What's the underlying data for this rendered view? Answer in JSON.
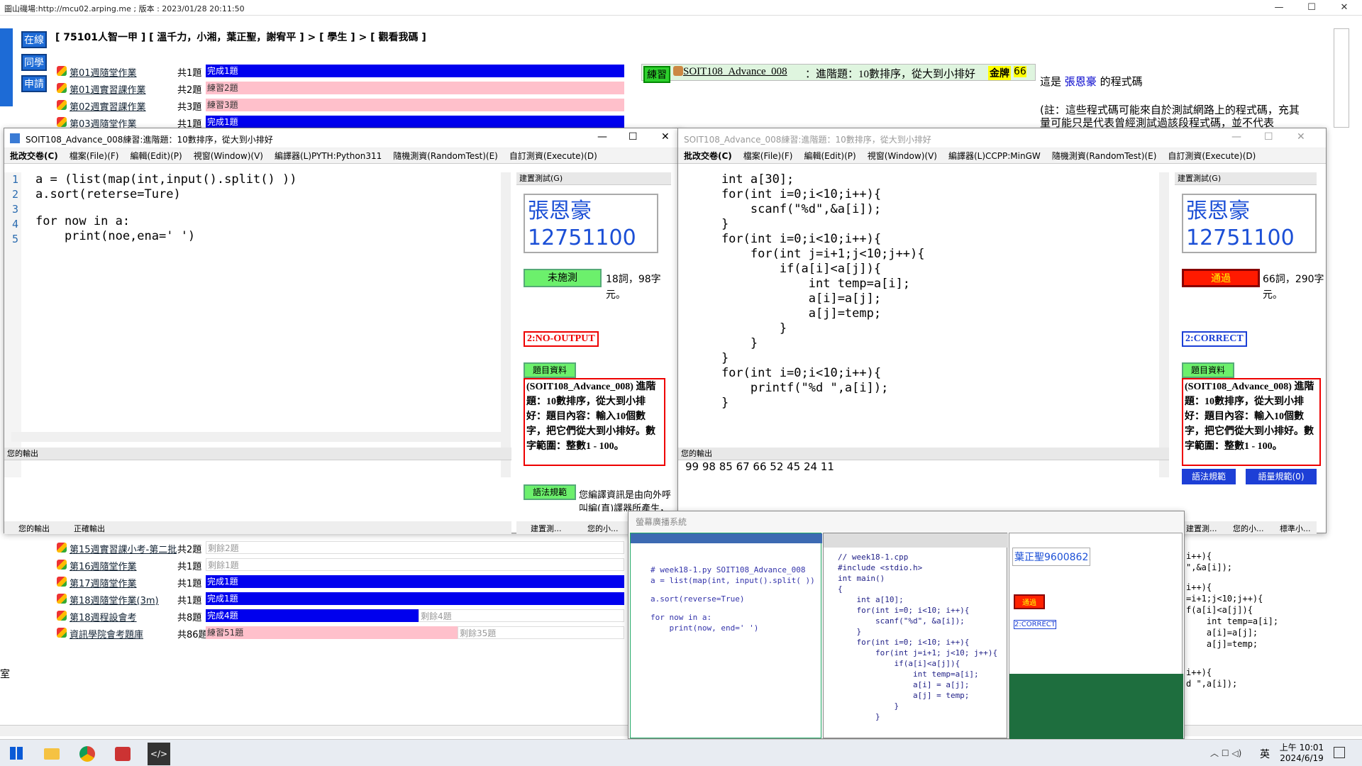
{
  "titlebar": {
    "text": "圖山磯場:http://mcu02.arping.me ; 版本 : 2023/01/28 20:11:50",
    "min": "—",
    "max": "☐",
    "close": "✕"
  },
  "nav": {
    "online": "在線",
    "classmates": "同學",
    "appeal": "申請"
  },
  "crumb": "[ 75101人智一甲 ] [ 溫千力，小湘，葉正聖，謝宥平 ] > [ 學生 ] > [ 觀看我碼 ]",
  "rows_top": [
    {
      "name": "第01週隨堂作業",
      "count": "共1題",
      "status": "完成1題",
      "style": "blue",
      "width": 590
    },
    {
      "name": "第01週實習課作業",
      "count": "共2題",
      "status": "練習2題",
      "style": "pink",
      "width": 590
    },
    {
      "name": "第02週實習課作業",
      "count": "共3題",
      "status": "練習3題",
      "style": "pink",
      "width": 590
    },
    {
      "name": "第03週隨堂作業",
      "count": "共1題",
      "status": "完成1題",
      "style": "blue",
      "width": 590
    }
  ],
  "rows_bottom": [
    {
      "name": "第15週實習課小考-第二批",
      "count": "共2題",
      "status": "剩餘2題",
      "style": "gray",
      "width": 590
    },
    {
      "name": "第16週隨堂作業",
      "count": "共1題",
      "status": "剩餘1題",
      "style": "gray",
      "width": 590
    },
    {
      "name": "第17週隨堂作業",
      "count": "共1題",
      "status": "完成1題",
      "style": "blue",
      "width": 590
    },
    {
      "name": "第18週隨堂作業(3m)",
      "count": "共1題",
      "status": "完成1題",
      "style": "blue",
      "width": 590
    },
    {
      "name": "第18週程設會考",
      "count": "共8題",
      "status": "完成4題",
      "rest": "剩餘4題",
      "style": "blue",
      "width": 300
    },
    {
      "name": "資訊學院會考題庫",
      "count": "共86題",
      "status": "練習51題",
      "rest": "剩餘35題",
      "style": "pink",
      "width": 355
    }
  ],
  "problem_header": {
    "badge": "練習",
    "title": "SOIT108_Advance_008",
    "desc": "：進階題：10數排序，從大到小排好",
    "medal": "金牌",
    "score": "66"
  },
  "info": {
    "owner_prefix": "這是",
    "owner": "張恩豪",
    "owner_suffix": "的程式碼",
    "note": "(註：這些程式碼可能來自於測試網路上的程式碼，充其量可能只是代表曾經測試過該段程式碼，並不代表"
  },
  "left_win": {
    "title": "SOIT108_Advance_008練習:進階題：10數排序，從大到小排好",
    "menu": [
      "批改交卷(C)",
      "檔案(File)(F)",
      "編輯(Edit)(P)",
      "視窗(Window)(V)",
      "編譯器(L)PYTH:Python311",
      "隨機測資(RandomTest)(E)",
      "自訂測資(Execute)(D)"
    ],
    "lines": [
      "1",
      "2",
      "3",
      "4",
      "5"
    ],
    "code": [
      "a = (list(map(int,input().split() ))",
      "a.sort(reterse=Ture)",
      "",
      "for now in a:",
      "    print(noe,ena=' ')"
    ],
    "panel": "建置測試(G)",
    "name": "張恩豪",
    "id": "12751100",
    "status_btn": "未施測",
    "stats": "18詞，98字元。",
    "result": "2:NO-OUTPUT",
    "info_btn": "題目資料",
    "desc": "(SOIT108_Advance_008) 進階題：10數排序，從大到小排好：題目內容：輸入10個數字，把它們從大到小排好。數字範圍：整數1 - 100。",
    "syntax_btn": "語法規範",
    "syntax_note": "您編譯資訊是由向外呼叫編(直)譯器所產生，編(直)譯",
    "out_hdr": "您的輸出",
    "tabs": [
      "您的輸出",
      "正確輸出"
    ],
    "ptabs": [
      "建置測...",
      "您的小..."
    ]
  },
  "right_win": {
    "title": "SOIT108_Advance_008練習:進階題：10數排序，從大到小排好",
    "menu": [
      "批改交卷(C)",
      "檔案(File)(F)",
      "編輯(Edit)(P)",
      "視窗(Window)(V)",
      "編譯器(L)CCPP:MinGW",
      "隨機測資(RandomTest)(E)",
      "自訂測資(Execute)(D)"
    ],
    "code": [
      "    int a[30];",
      "    for(int i=0;i<10;i++){",
      "        scanf(\"%d\",&a[i]);",
      "    }",
      "    for(int i=0;i<10;i++){",
      "        for(int j=i+1;j<10;j++){",
      "            if(a[i]<a[j]){",
      "                int temp=a[i];",
      "                a[i]=a[j];",
      "                a[j]=temp;",
      "            }",
      "        }",
      "    }",
      "    for(int i=0;i<10;i++){",
      "        printf(\"%d \",a[i]);",
      "    }"
    ],
    "panel": "建置測試(G)",
    "name": "張恩豪",
    "id": "12751100",
    "status_btn": "通過",
    "stats": "66詞，290字元。",
    "result": "2:CORRECT",
    "info_btn": "題目資料",
    "desc": "(SOIT108_Advance_008) 進階題：10數排序，從大到小排好：題目內容：輸入10個數字，把它們從大到小排好。數字範圍：整數1 - 100。",
    "syntax_btn": "語法規範",
    "norm_btn": "語量規範(0)",
    "out_hdr": "您的輸出",
    "output": "99 98 85 67 66 52 45 24 11",
    "ptabs": [
      "建置測...",
      "您的小...",
      "標準小..."
    ]
  },
  "broadcast": {
    "title": "螢幕廣播系統",
    "py": [
      "# week18-1.py SOIT108_Advance_008",
      "a = list(map(int, input().split( ))",
      "",
      "a.sort(reverse=True)",
      "",
      "for now in a:",
      "    print(now, end=' ')"
    ],
    "c": [
      "// week18-1.cpp",
      "#include <stdio.h>",
      "int main()",
      "{",
      "    int a[10];",
      "    for(int i=0; i<10; i++){",
      "        scanf(\"%d\", &a[i]);",
      "    }",
      "    for(int i=0; i<10; i++){",
      "        for(int j=i+1; j<10; j++){",
      "            if(a[i]<a[j]){",
      "                int temp=a[i];",
      "                a[i] = a[j];",
      "                a[j] = temp;",
      "            }",
      "        }"
    ],
    "name": "葉正聖9600862",
    "pass": "通過",
    "correct": "2:CORRECT"
  },
  "bg_code": [
    "i++){",
    "\",&a[i]);",
    "",
    "i++){",
    "=i+1;j<10;j++){",
    "f(a[i]<a[j]){",
    "    int temp=a[i];",
    "    a[i]=a[j];",
    "    a[j]=temp;",
    "",
    "",
    "i++){",
    "d \",a[i]);"
  ],
  "edge_text": "室",
  "taskbar": {
    "ime": "英",
    "time": "上午 10:01",
    "date": "2024/6/19"
  }
}
